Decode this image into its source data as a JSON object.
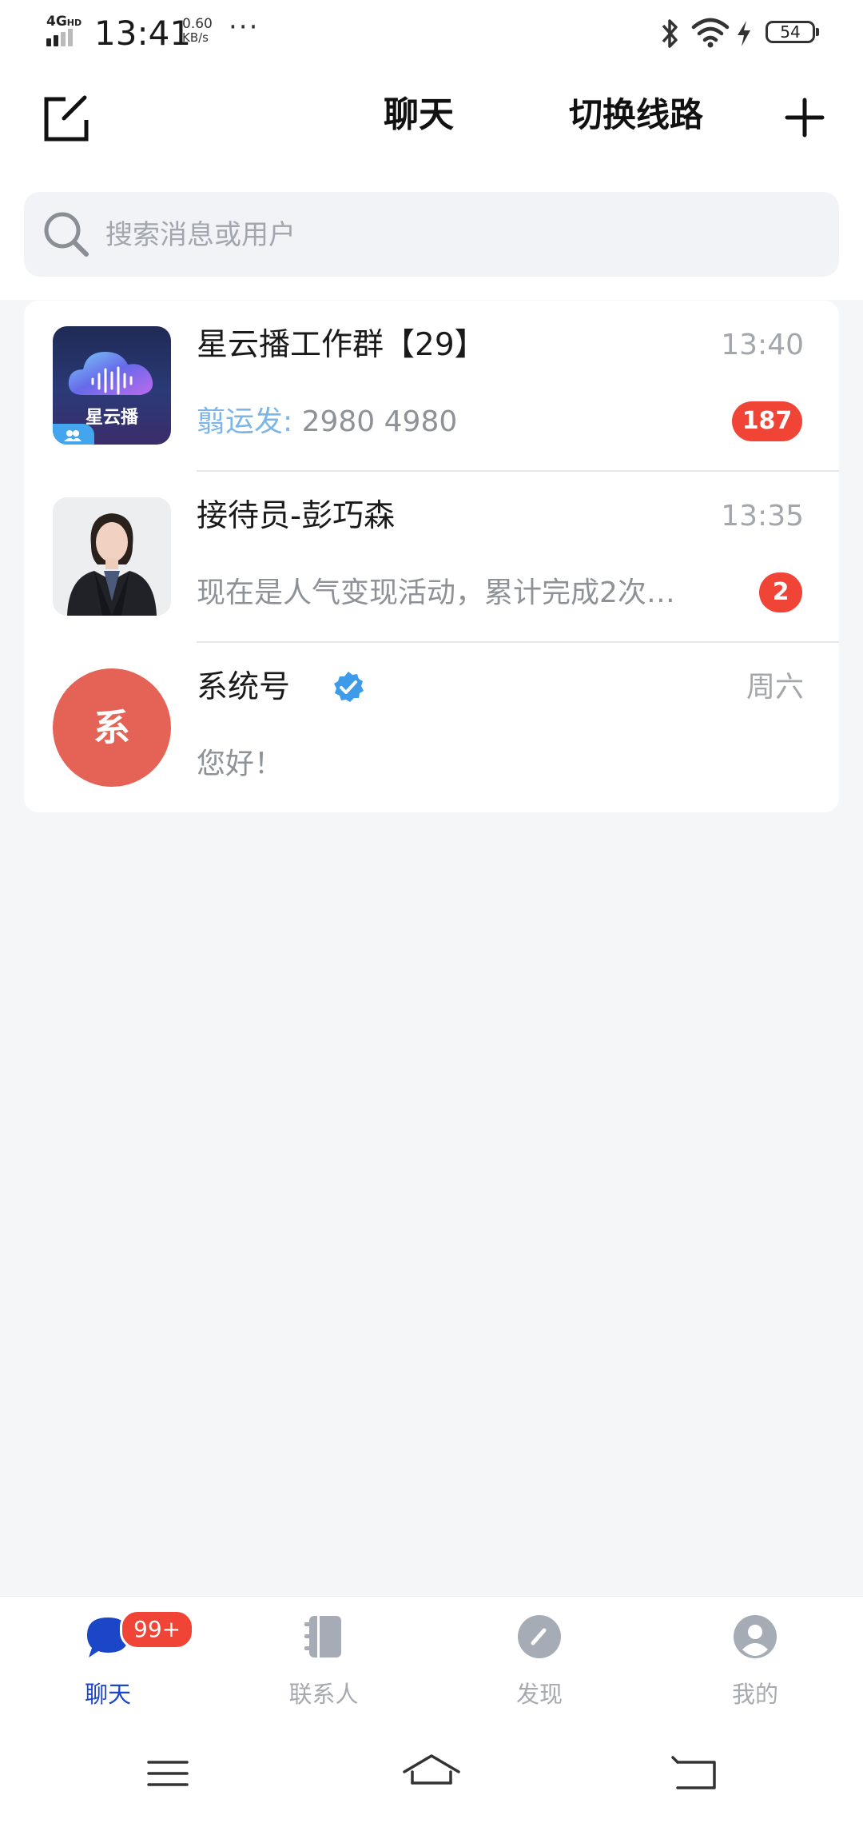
{
  "status_bar": {
    "network": "4G",
    "network_sup": "HD",
    "time": "13:41",
    "speed_value": "0.60",
    "speed_unit": "KB/s",
    "more": "···",
    "battery": "54"
  },
  "header": {
    "title": "聊天",
    "switch_route": "切换线路"
  },
  "search": {
    "placeholder": "搜索消息或用户"
  },
  "chats": [
    {
      "name": "星云播工作群【29】",
      "time": "13:40",
      "sender": "翦运发:",
      "preview": " 2980 4980",
      "unread": "187",
      "avatar_text": "星云播"
    },
    {
      "name": "接待员-彭巧森",
      "time": "13:35",
      "preview": "现在是人气变现活动，累计完成2次…",
      "unread": "2"
    },
    {
      "name": "系统号",
      "time": "周六",
      "preview": "您好！",
      "avatar_text": "系"
    }
  ],
  "tabbar": {
    "chat": "聊天",
    "chat_badge": "99+",
    "contacts": "联系人",
    "discover": "发现",
    "me": "我的"
  },
  "colors": {
    "accent": "#1c46c8",
    "badge": "#f04436",
    "verified": "#3d9bea"
  }
}
